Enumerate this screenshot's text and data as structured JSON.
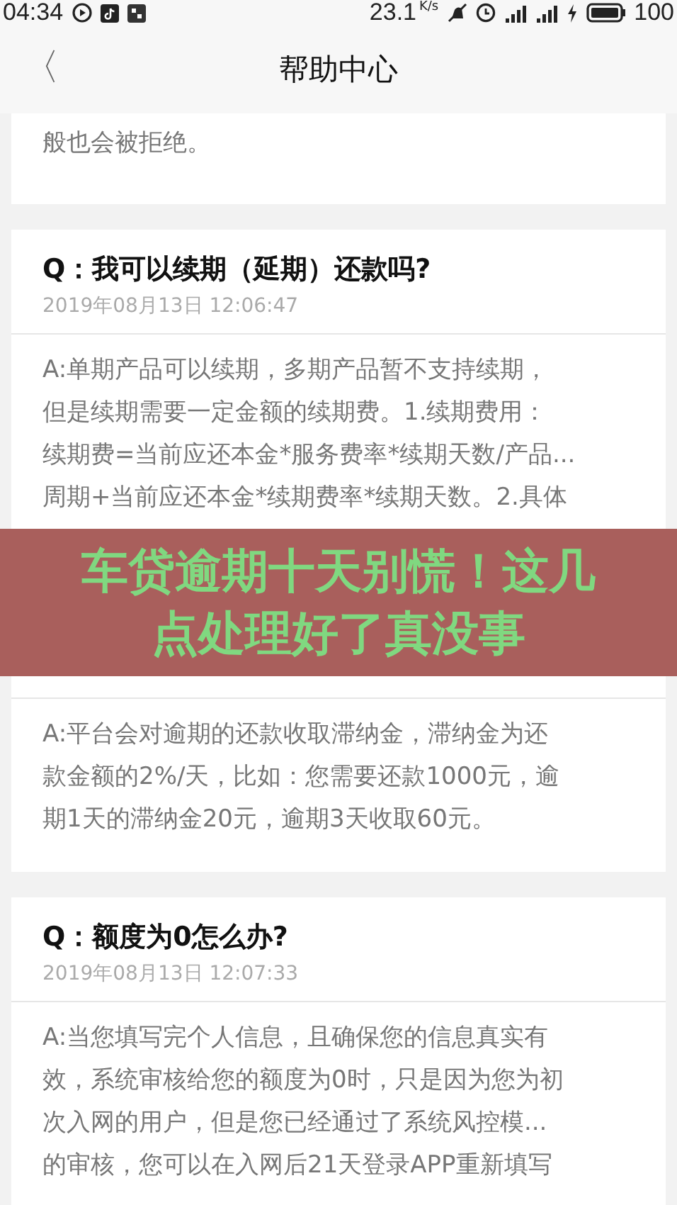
{
  "status_bar": {
    "time": "04:34",
    "speed": "23.1",
    "speed_unit": "K/s",
    "battery": "100"
  },
  "nav": {
    "back": "〈",
    "title": "帮助中心"
  },
  "faqs": [
    {
      "kind": "tail",
      "answer_lines": [
        "般也会被拒绝。"
      ]
    },
    {
      "kind": "full",
      "question": "Q：我可以续期（延期）还款吗?",
      "date": "2019年08月13日 12:06:47",
      "answer_lines": [
        "A:单期产品可以续期，多期产品暂不支持续期，",
        "但是续期需要一定金额的续期费。1.续期费用：",
        "续期费=当前应还本金*服务费率*续期天数/产品...",
        "周期+当前应还本金*续期费率*续期天数。2.具体"
      ]
    },
    {
      "kind": "covered",
      "answer_lines": [
        "A:平台会对逾期的还款收取滞纳金，滞纳金为还",
        "款金额的2%/天，比如：您需要还款1000元，逾",
        "期1天的滞纳金20元，逾期3天收取60元。"
      ]
    },
    {
      "kind": "full",
      "question": "Q：额度为0怎么办?",
      "date": "2019年08月13日 12:07:33",
      "answer_lines": [
        "A:当您填写完个人信息，且确保您的信息真实有",
        "效，系统审核给您的额度为0时，只是因为您为初",
        "次入网的用户，但是您已经通过了系统风控模...",
        "的审核，您可以在入网后21天登录APP重新填写"
      ]
    }
  ],
  "banner": {
    "lines": [
      "车贷逾期十天别慌！这几",
      "点处理好了真没事"
    ]
  }
}
